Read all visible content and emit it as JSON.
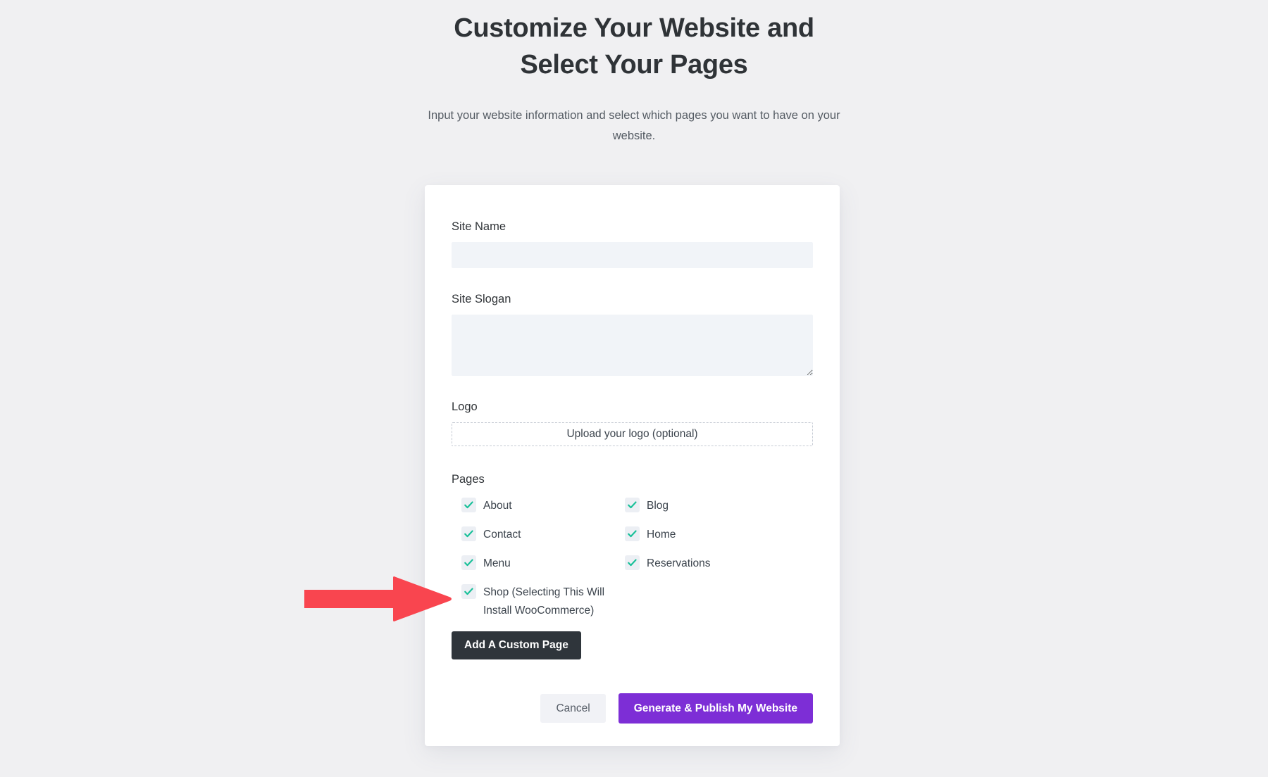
{
  "header": {
    "title": "Customize Your Website and Select Your Pages",
    "subtitle": "Input your website information and select which pages you want to have on your website."
  },
  "form": {
    "site_name": {
      "label": "Site Name",
      "value": "",
      "placeholder": ""
    },
    "site_slogan": {
      "label": "Site Slogan",
      "value": "",
      "placeholder": ""
    },
    "logo": {
      "label": "Logo",
      "upload_text": "Upload your logo (optional)"
    },
    "pages": {
      "label": "Pages",
      "items": [
        {
          "label": "About",
          "checked": true
        },
        {
          "label": "Blog",
          "checked": true
        },
        {
          "label": "Contact",
          "checked": true
        },
        {
          "label": "Home",
          "checked": true
        },
        {
          "label": "Menu",
          "checked": true
        },
        {
          "label": "Reservations",
          "checked": true
        },
        {
          "label": "Shop (Selecting This Will Install WooCommerce)",
          "checked": true
        }
      ]
    },
    "add_custom_page_label": "Add A Custom Page"
  },
  "actions": {
    "cancel_label": "Cancel",
    "submit_label": "Generate & Publish My Website"
  },
  "annotation": {
    "arrow": "red-arrow-pointing-to-shop-checkbox"
  },
  "colors": {
    "page_background": "#f0f0f2",
    "card_background": "#ffffff",
    "input_background": "#f1f4f8",
    "checkbox_background": "#eceff4",
    "check_green": "#17c098",
    "primary_purple": "#7d2ed6",
    "dark_button": "#2f353b",
    "cancel_button": "#f1f2f6",
    "arrow_red": "#f9454f",
    "title_text": "#2f3337",
    "body_text": "#3c444d"
  }
}
